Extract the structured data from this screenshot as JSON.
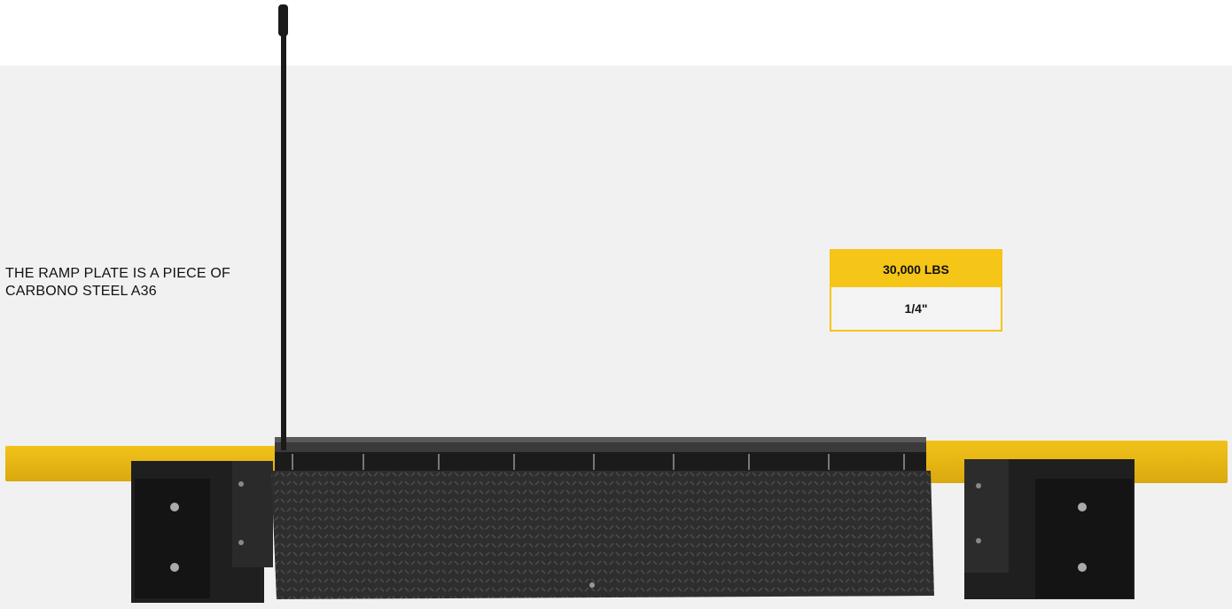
{
  "caption": {
    "line1": "THE RAMP PLATE IS A PIECE OF",
    "line2": "CARBONO STEEL A36"
  },
  "spec": {
    "capacity": "30,000 LBS",
    "plate_thickness": "1/4\""
  },
  "colors": {
    "accent_yellow": "#f5c518",
    "background": "#f1f1f1",
    "steel_dark": "#2b2b2b"
  },
  "image": {
    "subject": "dock-leveler-product-photo",
    "icons": [
      "rubber-bumper-icon",
      "pull-chain-rod-icon"
    ]
  }
}
